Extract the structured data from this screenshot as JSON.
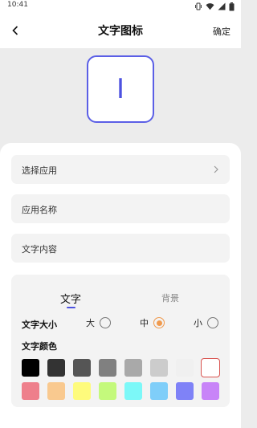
{
  "status_bar": {
    "time": "10:41"
  },
  "nav": {
    "title": "文字图标",
    "confirm_label": "确定"
  },
  "preview": {
    "icon_text": "I",
    "accent_color": "#4d52e0"
  },
  "form": {
    "select_app_label": "选择应用",
    "app_name_label": "应用名称",
    "text_content_label": "文字内容"
  },
  "style_panel": {
    "tabs": [
      {
        "label": "文字",
        "active": true
      },
      {
        "label": "背景",
        "active": false
      }
    ],
    "size": {
      "label": "文字大小",
      "options": [
        {
          "label": "大",
          "selected": false
        },
        {
          "label": "中",
          "selected": true
        },
        {
          "label": "小",
          "selected": false
        }
      ]
    },
    "color": {
      "label": "文字颜色",
      "swatches_row1": [
        "#000000",
        "#333333",
        "#555555",
        "#808080",
        "#a9a9a9",
        "#cccccc",
        "#f0f0f0",
        "#ffffff"
      ],
      "swatches_row2": [
        "#ee7f8b",
        "#f9c98f",
        "#fefb7c",
        "#c4f97c",
        "#7cf8f8",
        "#7fcef9",
        "#7f82f7",
        "#c884f8"
      ],
      "selected_color": "#ffffff"
    }
  }
}
